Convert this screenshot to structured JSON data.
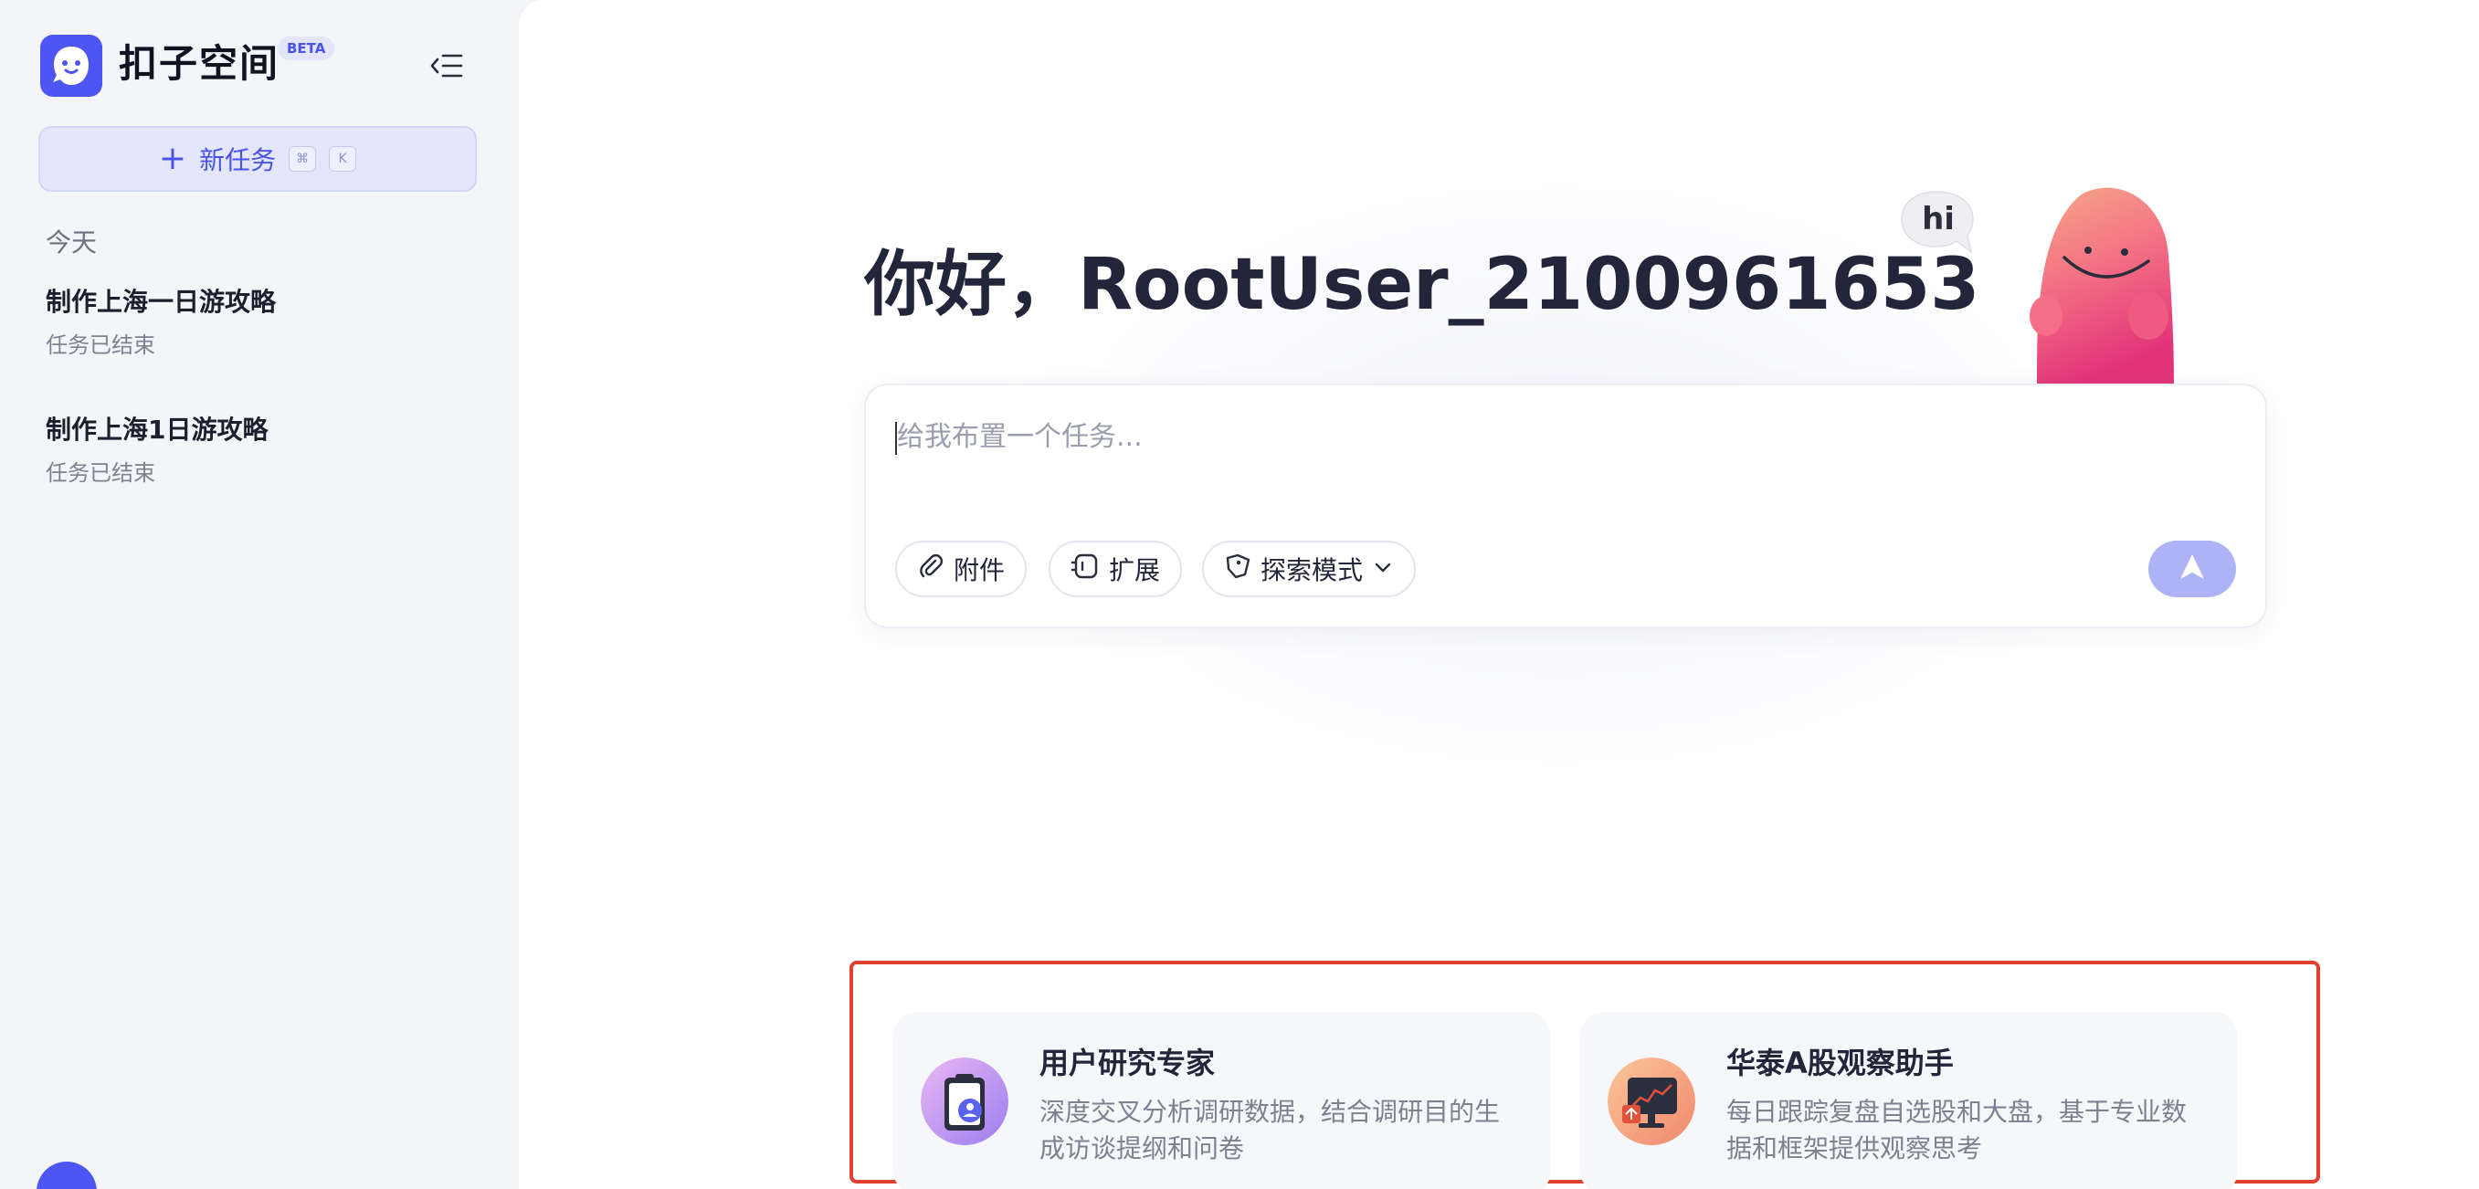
{
  "app": {
    "name": "扣子空间",
    "badge": "BETA"
  },
  "sidebar": {
    "new_task_label": "新任务",
    "shortcut_keys": [
      "⌘",
      "K"
    ],
    "section_today": "今天",
    "history": [
      {
        "title": "制作上海一日游攻略",
        "status": "任务已结束"
      },
      {
        "title": "制作上海1日游攻略",
        "status": "任务已结束"
      }
    ]
  },
  "main": {
    "greeting": "你好，RootUser_2100961653",
    "mascot_bubble": "hi",
    "input_placeholder": "给我布置一个任务...",
    "chips": {
      "attach": "附件",
      "extend": "扩展",
      "mode": "探索模式"
    }
  },
  "agents": [
    {
      "title": "用户研究专家",
      "desc": "深度交叉分析调研数据，结合调研目的生成访谈提纲和问卷"
    },
    {
      "title": "华泰A股观察助手",
      "desc": "每日跟踪复盘自选股和大盘，基于专业数据和框架提供观察思考"
    }
  ],
  "colors": {
    "brand": "#4d55f5",
    "highlight_frame": "#e0402e",
    "send_button": "#aeb3f7"
  }
}
